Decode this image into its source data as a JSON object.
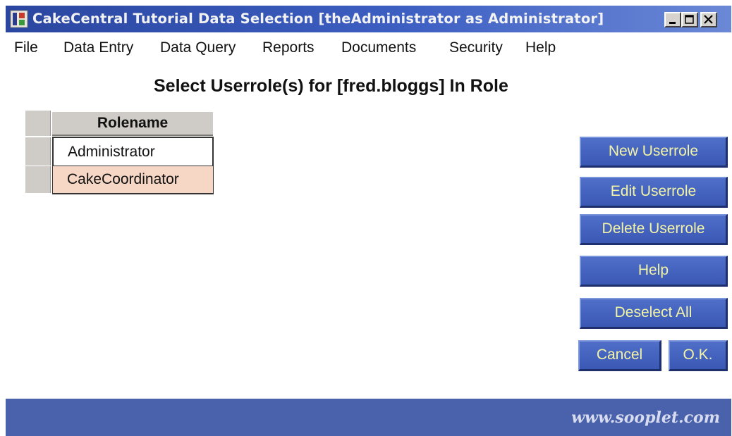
{
  "window": {
    "title": "CakeCentral Tutorial Data Selection [theAdministrator as Administrator]"
  },
  "menu": {
    "items": [
      "File",
      "Data Entry",
      "Data Query",
      "Reports",
      "Documents",
      "Security",
      "Help"
    ]
  },
  "page": {
    "title": "Select Userrole(s) for [fred.bloggs] In Role"
  },
  "table": {
    "column_header": "Rolename",
    "rows": [
      "Administrator",
      "CakeCoordinator"
    ],
    "selected_row": 1
  },
  "buttons": {
    "new": "New Userrole",
    "edit": "Edit Userrole",
    "delete": "Delete Userrole",
    "help": "Help",
    "deselect": "Deselect All",
    "cancel": "Cancel",
    "ok": "O.K."
  },
  "footer": {
    "text": "www.sooplet.com"
  },
  "colors": {
    "titlebar": "#3d5fc2",
    "button": "#3a58b4",
    "button_text": "#f3f3a6",
    "selected_row": "#f6d6c4",
    "footer": "#4a62ab"
  },
  "icons": [
    "app-icon",
    "minimize-icon",
    "maximize-icon",
    "close-icon"
  ]
}
